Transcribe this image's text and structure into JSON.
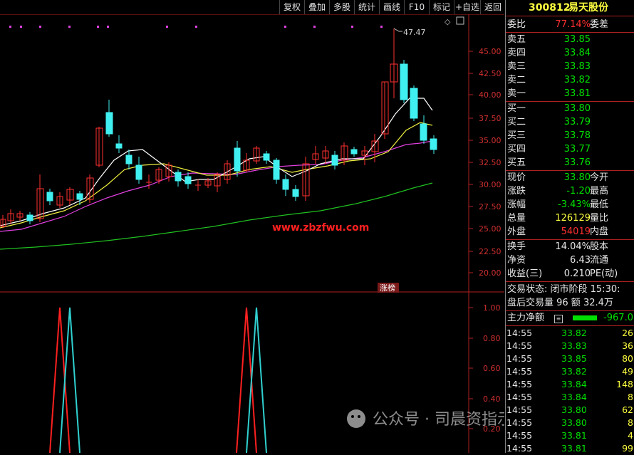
{
  "toolbar": {
    "buttons": [
      "复权",
      "叠加",
      "多股",
      "统计",
      "画线",
      "F10",
      "标记",
      "+自选",
      "返回"
    ]
  },
  "stock": {
    "code": "300812",
    "name": "易天股份"
  },
  "main_chart": {
    "price_labels": [
      "45.00",
      "42.50",
      "40.00",
      "37.50",
      "35.00",
      "32.50",
      "30.00",
      "27.50",
      "25.00",
      "22.50",
      "20.00"
    ],
    "high_annotation": "47.47",
    "watermark_url": "www.zbzfwu.com",
    "tag_label": "涨榜"
  },
  "sub_chart": {
    "labels": [
      "1.00",
      "0.80",
      "0.60",
      "0.40",
      "0.20"
    ]
  },
  "quote": {
    "weibi_label": "委比",
    "weibi_value": "77.14%",
    "weicha_label": "委差",
    "asks": [
      {
        "label": "卖五",
        "price": "33.85"
      },
      {
        "label": "卖四",
        "price": "33.84"
      },
      {
        "label": "卖三",
        "price": "33.83"
      },
      {
        "label": "卖二",
        "price": "33.82"
      },
      {
        "label": "卖一",
        "price": "33.81"
      }
    ],
    "bids": [
      {
        "label": "买一",
        "price": "33.80"
      },
      {
        "label": "买二",
        "price": "33.79"
      },
      {
        "label": "买三",
        "price": "33.78"
      },
      {
        "label": "买四",
        "price": "33.77"
      },
      {
        "label": "买五",
        "price": "33.76"
      }
    ],
    "stats": [
      {
        "label": "现价",
        "value": "33.80",
        "label2": "今开"
      },
      {
        "label": "涨跌",
        "value": "-1.20",
        "label2": "最高"
      },
      {
        "label": "涨幅",
        "value": "-3.43%",
        "label2": "最低"
      },
      {
        "label": "总量",
        "value": "126129",
        "label2": "量比"
      },
      {
        "label": "外盘",
        "value": "54019",
        "label2": "内盘"
      }
    ],
    "stats2": [
      {
        "label": "换手",
        "value": "14.04%",
        "label2": "股本"
      },
      {
        "label": "净资",
        "value": "6.43",
        "label2": "流通"
      },
      {
        "label": "收益(三)",
        "value": "0.210",
        "label2": "PE(动)"
      }
    ],
    "trade_status": "交易状态: 闭市阶段 15:30:",
    "after_hours": "盘后交易量 96 额 32.4万",
    "main_force_label": "主力净额",
    "main_force_value": "-967.0"
  },
  "ticks": [
    {
      "time": "14:55",
      "price": "33.82",
      "vol": "26"
    },
    {
      "time": "14:55",
      "price": "33.83",
      "vol": "36"
    },
    {
      "time": "14:55",
      "price": "33.85",
      "vol": "80"
    },
    {
      "time": "14:55",
      "price": "33.82",
      "vol": "49"
    },
    {
      "time": "14:55",
      "price": "33.84",
      "vol": "148"
    },
    {
      "time": "14:55",
      "price": "33.84",
      "vol": "8"
    },
    {
      "time": "14:55",
      "price": "33.80",
      "vol": "62"
    },
    {
      "time": "14:55",
      "price": "33.80",
      "vol": "8"
    },
    {
      "time": "14:55",
      "price": "33.81",
      "vol": "4"
    },
    {
      "time": "14:55",
      "price": "33.81",
      "vol": "99"
    }
  ],
  "wechat_watermark": "公众号 · 司晨资指示所"
}
